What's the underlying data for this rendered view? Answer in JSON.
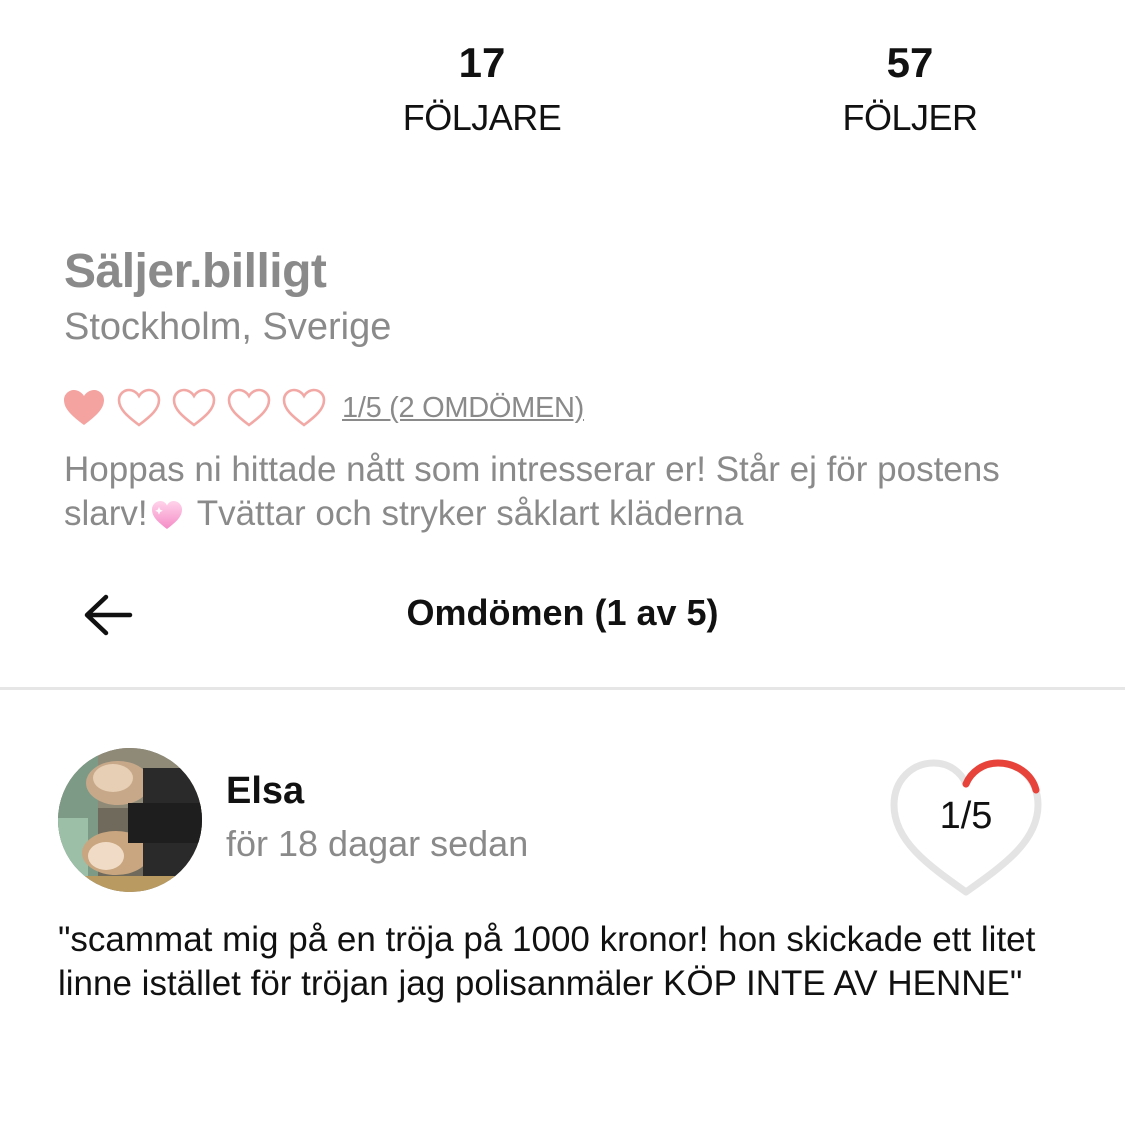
{
  "stats": {
    "followers": {
      "count": "17",
      "label": "FÖLJARE"
    },
    "following": {
      "count": "57",
      "label": "FÖLJER"
    }
  },
  "profile": {
    "name": "Säljer.billigt",
    "location": "Stockholm, Sverige",
    "rating": {
      "filled": 1,
      "max": 5,
      "link_text": "1/5 (2 OMDÖMEN)"
    },
    "bio_part1": "Hoppas ni hittade nått som intresserar er! Står ej för postens slarv!",
    "bio_emoji": "sparkling-heart-emoji",
    "bio_part2": " Tvättar och stryker såklart kläderna"
  },
  "reviews_modal": {
    "title": "Omdömen (1 av 5)",
    "back_icon": "arrow-left-icon",
    "review": {
      "reviewer": "Elsa",
      "time": "för 18 dagar sedan",
      "score_text": "1/5",
      "score_fraction": 0.2,
      "text": "\"scammat mig på en tröja på 1000 kronor! hon skickade ett litet linne istället för tröjan jag polisanmäler KÖP INTE AV HENNE\""
    }
  },
  "colors": {
    "heart_filled": "#f4a3a0",
    "heart_outline": "#f2a9a5",
    "score_arc": "#e8433a",
    "score_track": "#e4e4e4",
    "muted_text": "#8a8a8a"
  }
}
